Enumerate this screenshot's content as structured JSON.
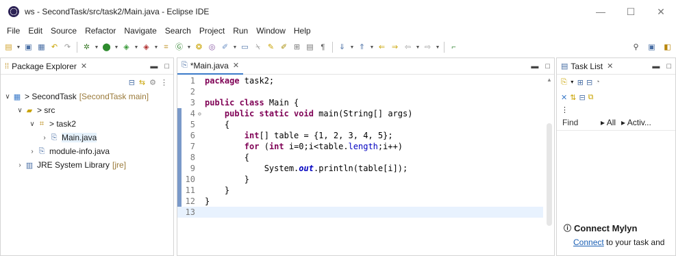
{
  "window": {
    "title": "ws - SecondTask/src/task2/Main.java - Eclipse IDE",
    "minimize": "—",
    "maximize": "☐",
    "close": "✕"
  },
  "menu": [
    "File",
    "Edit",
    "Source",
    "Refactor",
    "Navigate",
    "Search",
    "Project",
    "Run",
    "Window",
    "Help"
  ],
  "toolbar": {
    "search_icon": "search-icon",
    "perspective_icon": "open-perspective-icon"
  },
  "package_explorer": {
    "tab_label": "Package Explorer",
    "tree": {
      "project": "> SecondTask",
      "project_decoration": "[SecondTask main]",
      "src": "> src",
      "package": "> task2",
      "main_file": "Main.java",
      "module_info": "module-info.java",
      "jre": "JRE System Library",
      "jre_decoration": "[jre]"
    }
  },
  "editor": {
    "tab_label": "*Main.java",
    "lines": [
      {
        "n": "1",
        "fold": ""
      },
      {
        "n": "2",
        "fold": ""
      },
      {
        "n": "3",
        "fold": ""
      },
      {
        "n": "4",
        "fold": "⊖"
      },
      {
        "n": "5",
        "fold": ""
      },
      {
        "n": "6",
        "fold": ""
      },
      {
        "n": "7",
        "fold": ""
      },
      {
        "n": "8",
        "fold": ""
      },
      {
        "n": "9",
        "fold": ""
      },
      {
        "n": "10",
        "fold": ""
      },
      {
        "n": "11",
        "fold": ""
      },
      {
        "n": "12",
        "fold": ""
      },
      {
        "n": "13",
        "fold": ""
      }
    ],
    "code": {
      "l1_kw": "package",
      "l1_rest": " task2;",
      "l3_kw": "public class",
      "l3_rest": " Main {",
      "l4_indent": "    ",
      "l4_kw": "public static void",
      "l4_rest": " main(String[] args)",
      "l5": "    {",
      "l6_indent": "        ",
      "l6_kw": "int",
      "l6_rest": "[] table = {1, 2, 3, 4, 5};",
      "l7_indent": "        ",
      "l7_kw1": "for",
      "l7_mid1": " (",
      "l7_kw2": "int",
      "l7_mid2": " i=0;i<table.",
      "l7_field": "length",
      "l7_rest": ";i++)",
      "l8": "        {",
      "l9_indent": "            System.",
      "l9_static": "out",
      "l9_rest": ".println(table[i]);",
      "l10": "        }",
      "l11": "    }",
      "l12": "}",
      "l13": ""
    }
  },
  "task_list": {
    "tab_label": "Task List",
    "find_placeholder": "Find",
    "filter_all": "▸ All",
    "filter_active": "▸ Activ...",
    "mylyn_title": "Connect Mylyn",
    "mylyn_link": "Connect",
    "mylyn_rest": " to your task and"
  }
}
